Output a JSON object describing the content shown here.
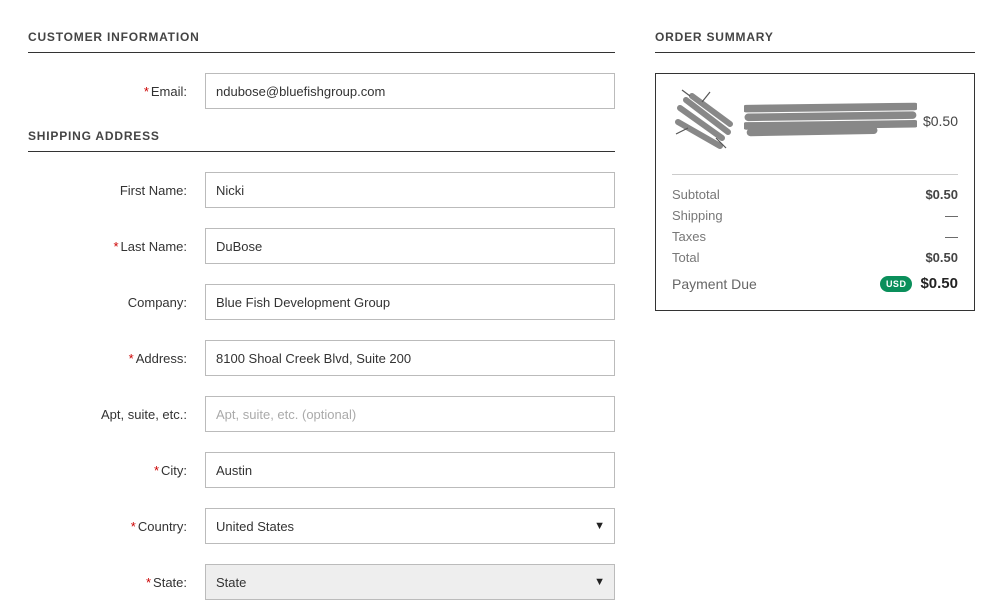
{
  "sections": {
    "customer_info_title": "CUSTOMER INFORMATION",
    "shipping_title": "SHIPPING ADDRESS",
    "order_summary_title": "ORDER SUMMARY"
  },
  "form": {
    "email": {
      "label": "Email:",
      "value": "ndubose@bluefishgroup.com",
      "required": true
    },
    "first_name": {
      "label": "First Name:",
      "value": "Nicki",
      "required": false
    },
    "last_name": {
      "label": "Last Name:",
      "value": "DuBose",
      "required": true
    },
    "company": {
      "label": "Company:",
      "value": "Blue Fish Development Group",
      "required": false
    },
    "address": {
      "label": "Address:",
      "value": "8100 Shoal Creek Blvd, Suite 200",
      "required": true
    },
    "apt": {
      "label": "Apt, suite, etc.:",
      "value": "",
      "placeholder": "Apt, suite, etc. (optional)",
      "required": false
    },
    "city": {
      "label": "City:",
      "value": "Austin",
      "required": true
    },
    "country": {
      "label": "Country:",
      "value": "United States",
      "required": true
    },
    "state": {
      "label": "State:",
      "value": "State",
      "required": true
    }
  },
  "order": {
    "item_price": "$0.50",
    "subtotal_label": "Subtotal",
    "subtotal_value": "$0.50",
    "shipping_label": "Shipping",
    "shipping_value": "—",
    "taxes_label": "Taxes",
    "taxes_value": "—",
    "total_label": "Total",
    "total_value": "$0.50",
    "payment_due_label": "Payment Due",
    "currency_badge": "USD",
    "payment_due_value": "$0.50"
  }
}
